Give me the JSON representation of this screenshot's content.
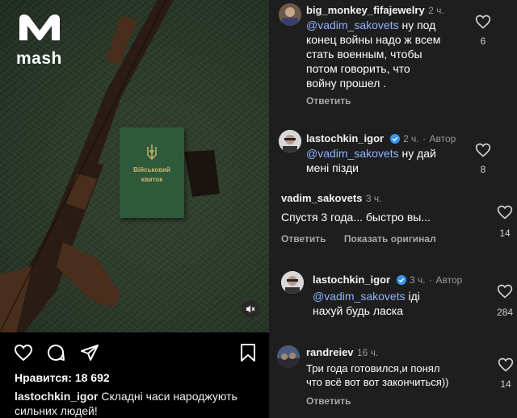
{
  "post": {
    "brand": "mash",
    "booklet_line1": "Військовий",
    "booklet_line2": "квиток",
    "likes_label": "Нравится: 18 692",
    "caption_user": "lastochkin_igor",
    "caption_text": " Складні часи народжують сильних людей!"
  },
  "comments": [
    {
      "username": "big_monkey_fifajewelry",
      "time": "2 ч.",
      "mention": "@vadim_sakovets",
      "lines": [
        "@vadim_sakovets ну под",
        "конец войны надо ж всем",
        "стать военным, чтобы",
        "потом говорить, что",
        "войну прошел ."
      ],
      "reply_label": "Ответить",
      "like_count": "6"
    },
    {
      "username": "lastochkin_igor",
      "time": "2 ч.",
      "author_label": "Автор",
      "lines": [
        "@vadim_sakovets ну дай",
        "мені пізди"
      ],
      "like_count": "8"
    },
    {
      "username": "vadim_sakovets",
      "time": "3 ч.",
      "lines": [
        "Спустя 3 года... быстро вы..."
      ],
      "reply_label": "Ответить",
      "show_original_label": "Показать оригинал",
      "like_count": "14"
    },
    {
      "username": "lastochkin_igor",
      "time": "3 ч.",
      "author_label": "Автор",
      "lines": [
        "@vadim_sakovets іді",
        "нахуй будь ласка"
      ],
      "like_count": "284"
    },
    {
      "username": "randreiev",
      "time": "16 ч.",
      "lines": [
        "Три года готовился,и  понял",
        "что всё вот вот закончиться))"
      ],
      "reply_label": "Ответить",
      "like_count": "14"
    }
  ],
  "colors": {
    "panel_bg": "#1e1e1e",
    "mention": "#8fb3ff",
    "verified": "#3897f0"
  }
}
